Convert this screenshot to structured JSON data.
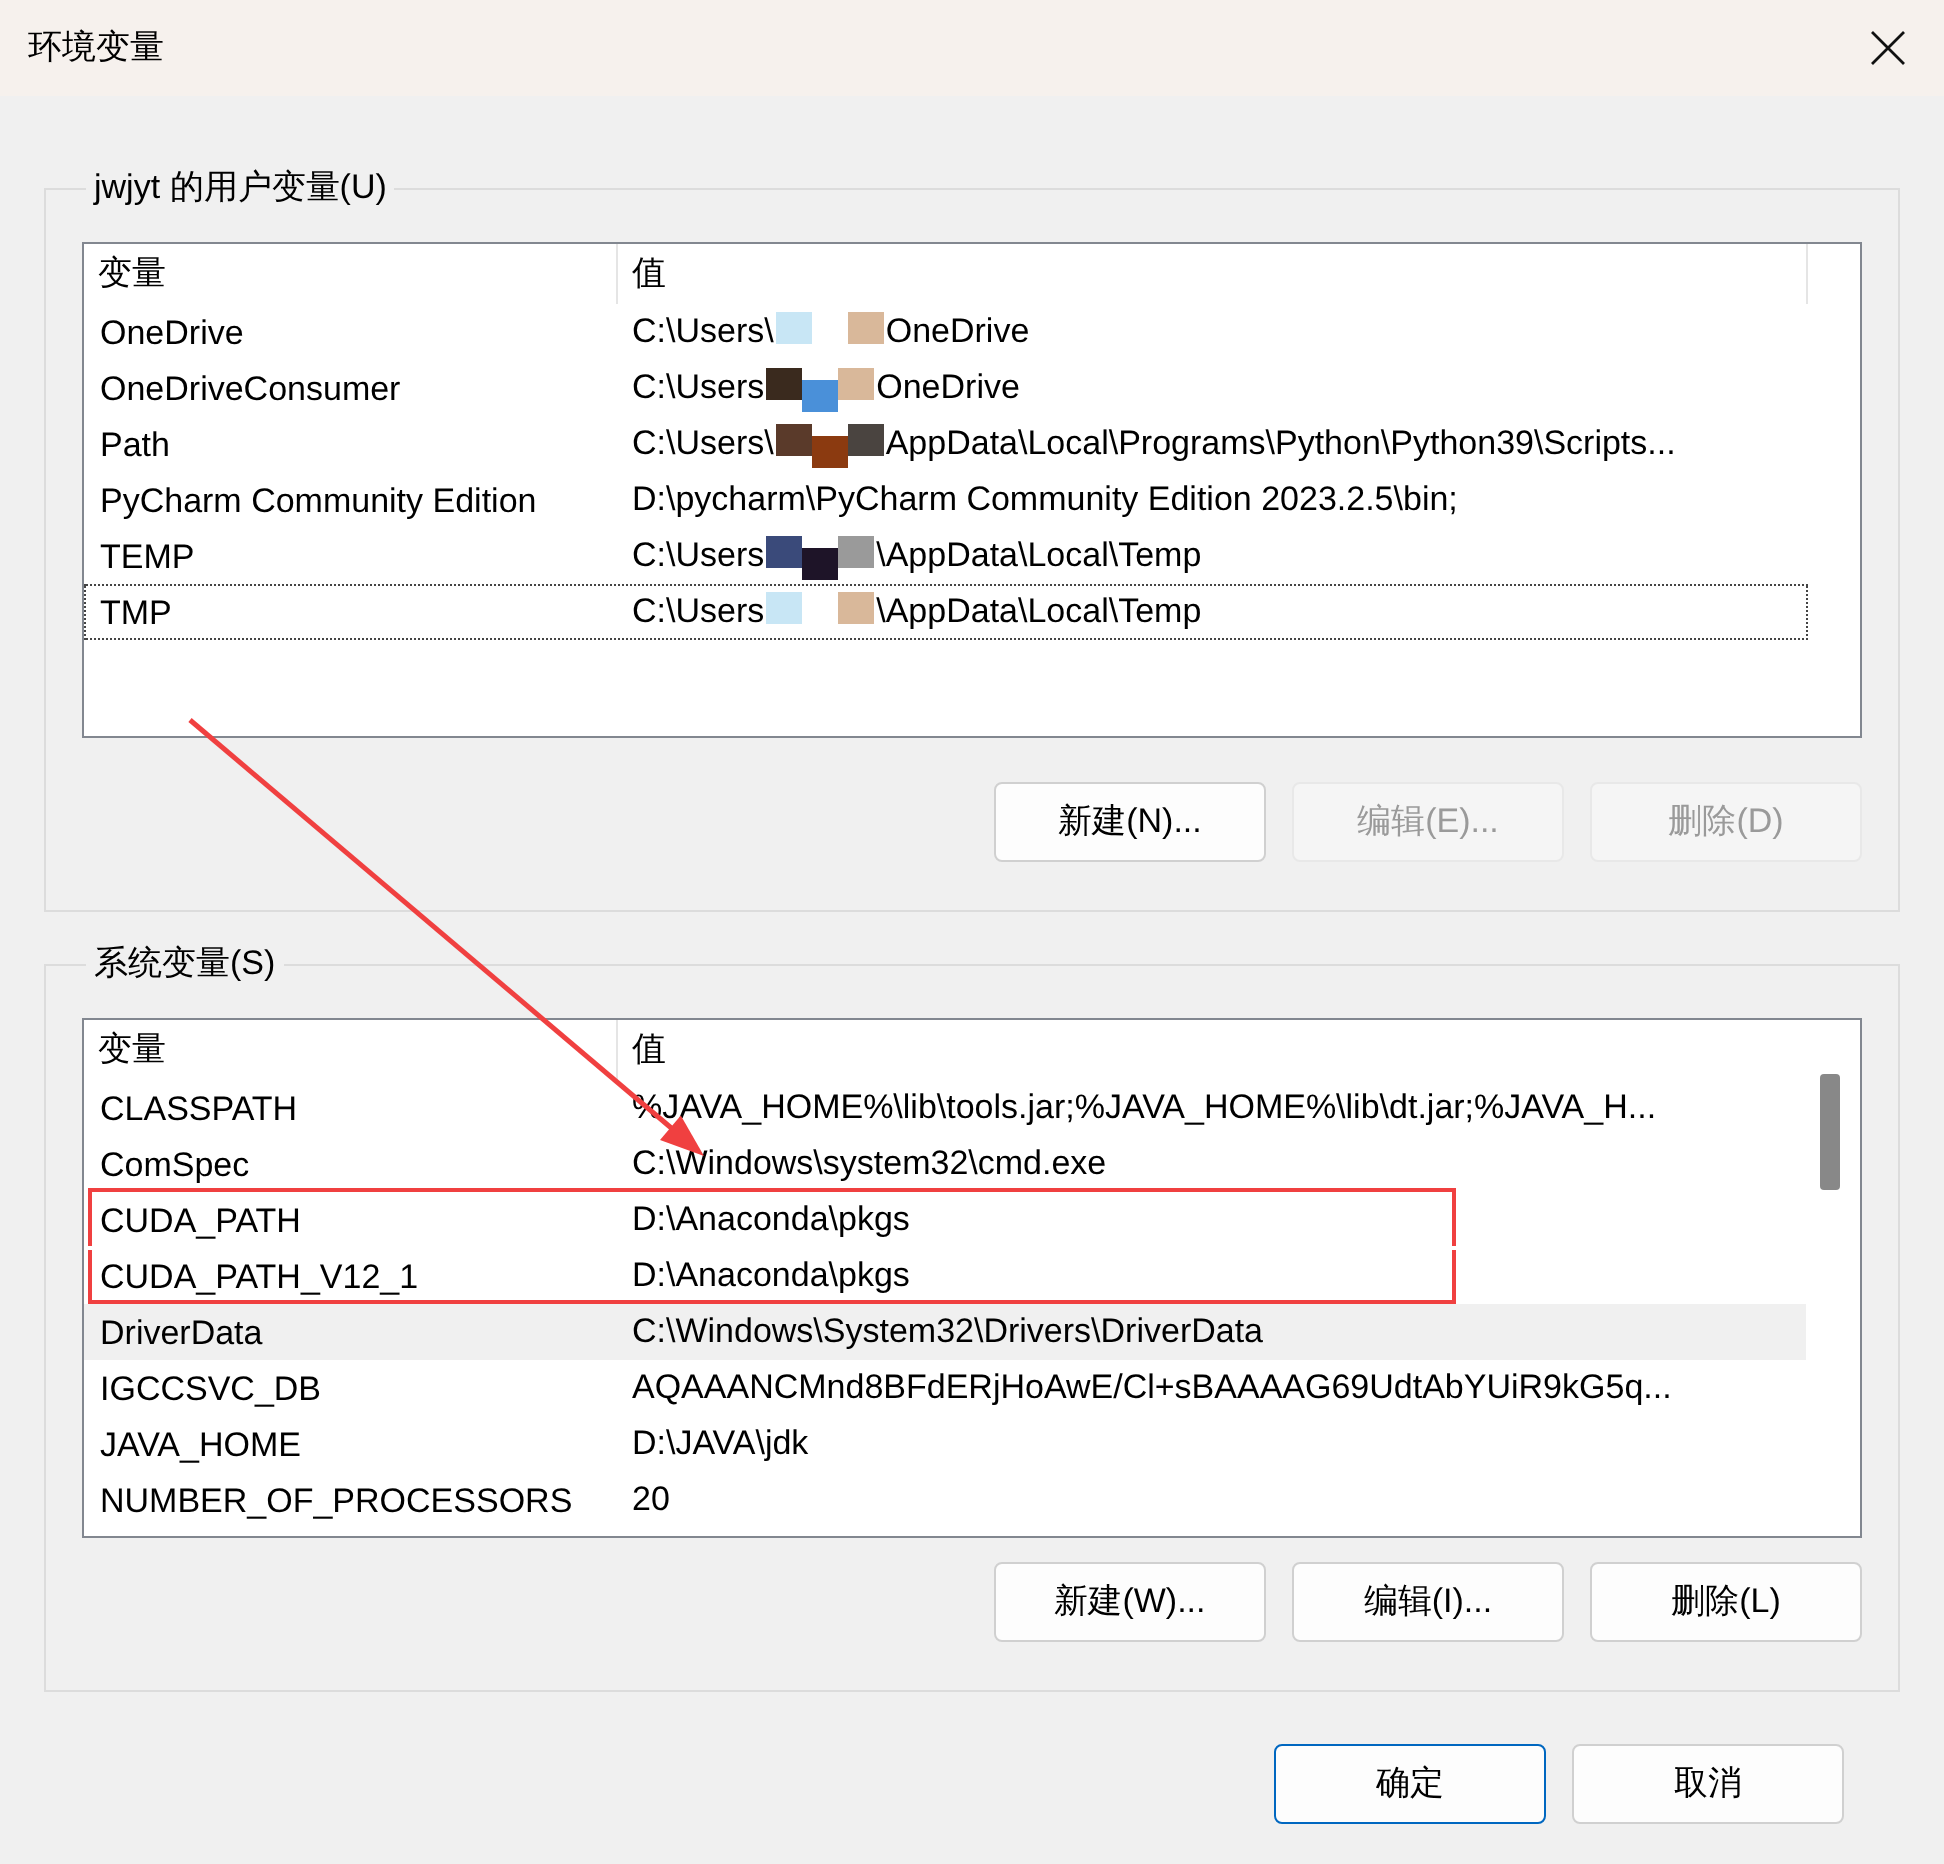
{
  "window": {
    "title": "环境变量"
  },
  "user_variables": {
    "legend": "jwjyt 的用户变量(U)",
    "columns": [
      "变量",
      "值"
    ],
    "rows": [
      {
        "name": "OneDrive",
        "value_parts": [
          "C:\\Users\\",
          "OneDrive"
        ],
        "selected": false,
        "focused": false,
        "outlined": false
      },
      {
        "name": "OneDriveConsumer",
        "value_parts": [
          "C:\\Users",
          "OneDrive"
        ],
        "selected": false,
        "focused": false,
        "outlined": false
      },
      {
        "name": "Path",
        "value_parts": [
          "C:\\Users\\",
          "AppData\\Local\\Programs\\Python\\Python39\\Scripts..."
        ],
        "selected": false,
        "focused": false,
        "outlined": false
      },
      {
        "name": "PyCharm Community Edition",
        "value": "D:\\pycharm\\PyCharm Community Edition 2023.2.5\\bin;",
        "selected": false,
        "focused": false,
        "outlined": false
      },
      {
        "name": "TEMP",
        "value_parts": [
          "C:\\Users",
          "\\AppData\\Local\\Temp"
        ],
        "selected": false,
        "focused": false,
        "outlined": false
      },
      {
        "name": "TMP",
        "value_parts": [
          "C:\\Users",
          "\\AppData\\Local\\Temp"
        ],
        "selected": false,
        "focused": true,
        "outlined": false
      }
    ],
    "buttons": [
      {
        "label": "新建(N)...",
        "disabled": false
      },
      {
        "label": "编辑(E)...",
        "disabled": true
      },
      {
        "label": "删除(D)",
        "disabled": true
      }
    ]
  },
  "system_variables": {
    "legend": "系统变量(S)",
    "columns": [
      "变量",
      "值"
    ],
    "rows": [
      {
        "name": "CLASSPATH",
        "value": "%JAVA_HOME%\\lib\\tools.jar;%JAVA_HOME%\\lib\\dt.jar;%JAVA_H...",
        "selected": false,
        "focused": false,
        "outlined": false
      },
      {
        "name": "ComSpec",
        "value": "C:\\Windows\\system32\\cmd.exe",
        "selected": false,
        "focused": false,
        "outlined": false
      },
      {
        "name": "CUDA_PATH",
        "value": "D:\\Anaconda\\pkgs",
        "selected": false,
        "focused": false,
        "outlined": true
      },
      {
        "name": "CUDA_PATH_V12_1",
        "value": "D:\\Anaconda\\pkgs",
        "selected": false,
        "focused": false,
        "outlined": true
      },
      {
        "name": "DriverData",
        "value": "C:\\Windows\\System32\\Drivers\\DriverData",
        "selected": true,
        "focused": false,
        "outlined": false
      },
      {
        "name": "IGCCSVC_DB",
        "value": "AQAAANCMnd8BFdERjHoAwE/Cl+sBAAAAG69UdtAbYUiR9kG5q...",
        "selected": false,
        "focused": false,
        "outlined": false
      },
      {
        "name": "JAVA_HOME",
        "value": "D:\\JAVA\\jdk",
        "selected": false,
        "focused": false,
        "outlined": false
      },
      {
        "name": "NUMBER_OF_PROCESSORS",
        "value": "20",
        "selected": false,
        "focused": false,
        "outlined": false
      }
    ],
    "buttons": [
      {
        "label": "新建(W)...",
        "disabled": false
      },
      {
        "label": "编辑(I)...",
        "disabled": false
      },
      {
        "label": "删除(L)",
        "disabled": false
      }
    ]
  },
  "annotations": [
    {
      "kind": "arrow"
    }
  ],
  "footer_buttons": [
    {
      "label": "确定",
      "default": true
    },
    {
      "label": "取消",
      "default": false
    }
  ]
}
